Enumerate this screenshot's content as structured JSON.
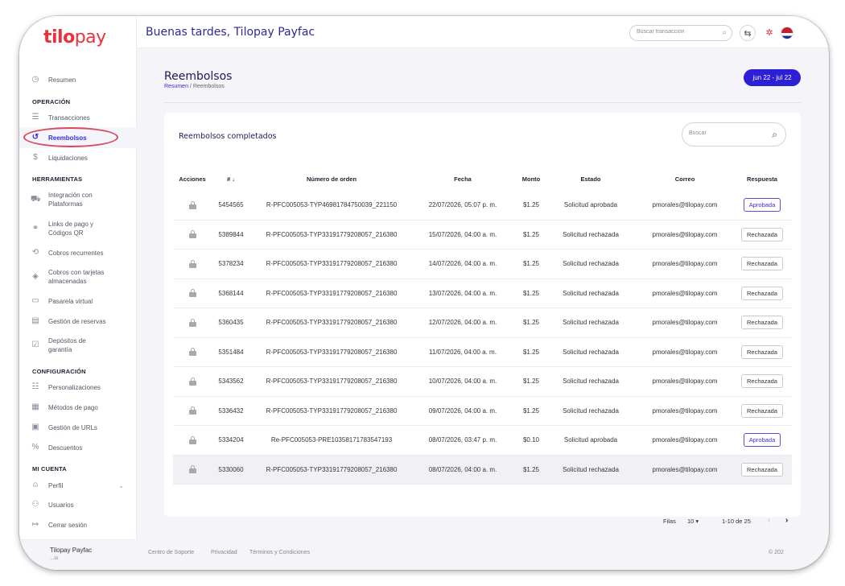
{
  "brand": {
    "logo_main": "tilo",
    "logo_pay": "pay"
  },
  "header": {
    "greeting": "Buenas tardes, Tilopay Payfac",
    "search_placeholder": "Buscar transacción"
  },
  "sidebar": {
    "resumen": "Resumen",
    "sections": {
      "operacion": "OPERACIÓN",
      "herramientas": "HERRAMIENTAS",
      "configuracion": "CONFIGURACIÓN",
      "mi_cuenta": "MI CUENTA"
    },
    "operacion": [
      "Transacciones",
      "Reembolsos",
      "Liquidaciones"
    ],
    "herramientas": [
      "Integración con Plataformas",
      "Links de pago y Códigos QR",
      "Cobros recurrentes",
      "Cobros con tarjetas almacenadas",
      "Pasarela virtual",
      "Gestión de reservas",
      "Depósitos de garantía"
    ],
    "configuracion": [
      "Personalizaciones",
      "Métodos de pago",
      "Gestión de URLs",
      "Descuentos"
    ],
    "mi_cuenta": [
      "Perfil",
      "Usuarios",
      "Cerrar sesión"
    ],
    "footer_name": "Tilopay Payfac",
    "footer_sub": "...io"
  },
  "page": {
    "title": "Reembolsos",
    "breadcrumb_home": "Resumen",
    "breadcrumb_sep": "/",
    "breadcrumb_current": "Reembolsos",
    "date_range": "jun 22 - jul 22"
  },
  "card": {
    "title": "Reembolsos completados",
    "search_placeholder": "Buscar"
  },
  "table": {
    "columns": {
      "acciones": "Acciones",
      "id": "# ↓",
      "orden": "Número de orden",
      "fecha": "Fecha",
      "monto": "Monto",
      "estado": "Estado",
      "correo": "Correo",
      "respuesta": "Respuesta"
    },
    "rows": [
      {
        "id": "5454565",
        "orden": "R-PFC005053-TYP46981784750039_221150",
        "fecha": "22/07/2026, 05:07 p. m.",
        "monto": "$1.25",
        "estado": "Solicitud aprobada",
        "correo": "pmorales@tilopay.com",
        "respuesta": "Aprobada"
      },
      {
        "id": "5389844",
        "orden": "R-PFC005053-TYP33191779208057_216380",
        "fecha": "15/07/2026, 04:00 a. m.",
        "monto": "$1.25",
        "estado": "Solicitud rechazada",
        "correo": "pmorales@tilopay.com",
        "respuesta": "Rechazada"
      },
      {
        "id": "5378234",
        "orden": "R-PFC005053-TYP33191779208057_216380",
        "fecha": "14/07/2026, 04:00 a. m.",
        "monto": "$1.25",
        "estado": "Solicitud rechazada",
        "correo": "pmorales@tilopay.com",
        "respuesta": "Rechazada"
      },
      {
        "id": "5368144",
        "orden": "R-PFC005053-TYP33191779208057_216380",
        "fecha": "13/07/2026, 04:00 a. m.",
        "monto": "$1.25",
        "estado": "Solicitud rechazada",
        "correo": "pmorales@tilopay.com",
        "respuesta": "Rechazada"
      },
      {
        "id": "5360435",
        "orden": "R-PFC005053-TYP33191779208057_216380",
        "fecha": "12/07/2026, 04:00 a. m.",
        "monto": "$1.25",
        "estado": "Solicitud rechazada",
        "correo": "pmorales@tilopay.com",
        "respuesta": "Rechazada"
      },
      {
        "id": "5351484",
        "orden": "R-PFC005053-TYP33191779208057_216380",
        "fecha": "11/07/2026, 04:00 a. m.",
        "monto": "$1.25",
        "estado": "Solicitud rechazada",
        "correo": "pmorales@tilopay.com",
        "respuesta": "Rechazada"
      },
      {
        "id": "5343562",
        "orden": "R-PFC005053-TYP33191779208057_216380",
        "fecha": "10/07/2026, 04:00 a. m.",
        "monto": "$1.25",
        "estado": "Solicitud rechazada",
        "correo": "pmorales@tilopay.com",
        "respuesta": "Rechazada"
      },
      {
        "id": "5336432",
        "orden": "R-PFC005053-TYP33191779208057_216380",
        "fecha": "09/07/2026, 04:00 a. m.",
        "monto": "$1.25",
        "estado": "Solicitud rechazada",
        "correo": "pmorales@tilopay.com",
        "respuesta": "Rechazada"
      },
      {
        "id": "5334204",
        "orden": "Re-PFC005053-PRE10358171783547193",
        "fecha": "08/07/2026, 03:47 p. m.",
        "monto": "$0.10",
        "estado": "Solicitud aprobada",
        "correo": "pmorales@tilopay.com",
        "respuesta": "Aprobada"
      },
      {
        "id": "5330060",
        "orden": "R-PFC005053-TYP33191779208057_216380",
        "fecha": "08/07/2026, 04:00 a. m.",
        "monto": "$1.25",
        "estado": "Solicitud rechazada",
        "correo": "pmorales@tilopay.com",
        "respuesta": "Rechazada"
      }
    ]
  },
  "pager": {
    "rows_label": "Filas",
    "rows_value": "10 ▾",
    "range": "1-10 de 25",
    "prev": "‹",
    "next": "›"
  },
  "footer": {
    "support": "Centro de Soporte",
    "privacy": "Privacidad",
    "terms": "Términos y Condiciones",
    "copyright": "© 202"
  },
  "icons": {
    "resumen": "clock-icon",
    "transacciones": "list-icon",
    "reembolsos": "refund-icon",
    "liquidaciones": "dollar-icon",
    "search": "search-icon",
    "swap": "swap-icon",
    "spark": "sparkle-icon",
    "flag": "flag-icon",
    "lock": "lock-icon"
  },
  "colors": {
    "accent": "#2d1fd6",
    "brand": "#e8323c",
    "title": "#1e1a5a"
  }
}
